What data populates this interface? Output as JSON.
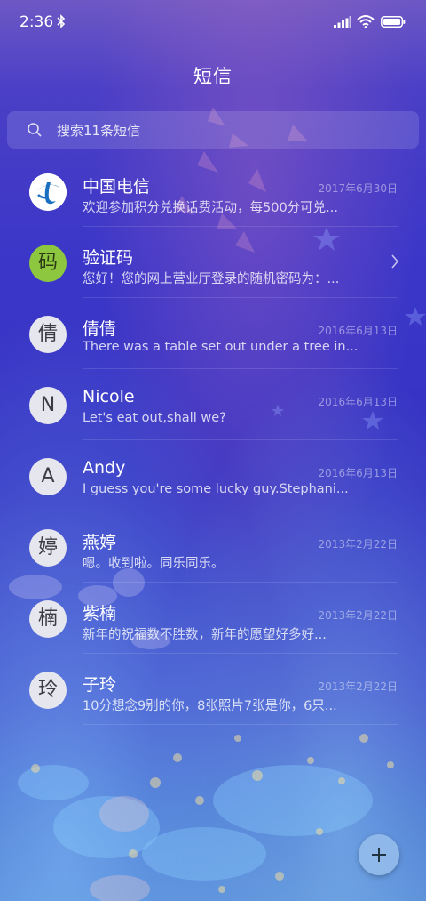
{
  "status_bar": {
    "time": "2:36"
  },
  "header": {
    "title": "短信"
  },
  "search": {
    "placeholder": "搜索11条短信"
  },
  "conversations": [
    {
      "avatar": "",
      "name": "中国电信",
      "date": "2017年6月30日",
      "preview": "欢迎参加积分兑换话费活动，每500分可兑..."
    },
    {
      "avatar": "码",
      "name": "验证码",
      "date": "",
      "preview": "您好！您的网上营业厅登录的随机密码为：..."
    },
    {
      "avatar": "倩",
      "name": "倩倩",
      "date": "2016年6月13日",
      "preview": "There was a table set out under a tree in..."
    },
    {
      "avatar": "N",
      "name": "Nicole",
      "date": "2016年6月13日",
      "preview": "Let's eat out,shall we?"
    },
    {
      "avatar": "A",
      "name": "Andy",
      "date": "2016年6月13日",
      "preview": "I guess you're some lucky guy.Stephani..."
    },
    {
      "avatar": "婷",
      "name": "燕婷",
      "date": "2013年2月22日",
      "preview": "嗯。收到啦。同乐同乐。"
    },
    {
      "avatar": "楠",
      "name": "紫楠",
      "date": "2013年2月22日",
      "preview": "新年的祝福数不胜数，新年的愿望好多好..."
    },
    {
      "avatar": "玲",
      "name": "子玲",
      "date": "2013年2月22日",
      "preview": "10分想念9别的你，8张照片7张是你，6只..."
    }
  ],
  "icons": {
    "bluetooth": "bluetooth-icon",
    "signal": "signal-icon",
    "wifi": "wifi-icon",
    "battery": "battery-icon",
    "search": "search-icon",
    "chevron": "chevron-right-icon",
    "compose": "plus-icon"
  }
}
